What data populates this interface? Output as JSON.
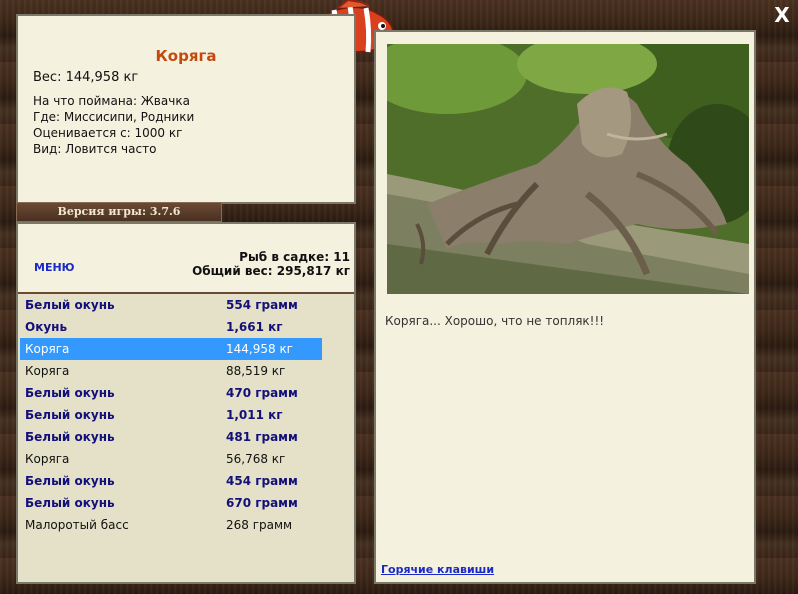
{
  "info": {
    "title": "Коряга",
    "weight": "Вес: 144,958 кг",
    "bait": "На что поймана: Жвачка",
    "location": "Где: Миссисипи, Родники",
    "value": "Оценивается с: 1000 кг",
    "frequency": "Вид: Ловится часто"
  },
  "version": "Версия игры: 3.7.6",
  "catch": {
    "menu_label": "МЕНЮ",
    "count": "Рыб в садке: 11",
    "total": "Общий вес: 295,817 кг",
    "rows": [
      {
        "name": "Белый окунь",
        "weight": "554 грамм",
        "style": "bold"
      },
      {
        "name": "Окунь",
        "weight": "1,661 кг",
        "style": "bold"
      },
      {
        "name": "Коряга",
        "weight": "144,958 кг",
        "style": "selected"
      },
      {
        "name": "Коряга",
        "weight": "88,519 кг",
        "style": "plain"
      },
      {
        "name": "Белый окунь",
        "weight": "470 грамм",
        "style": "bold"
      },
      {
        "name": "Белый окунь",
        "weight": "1,011 кг",
        "style": "bold"
      },
      {
        "name": "Белый окунь",
        "weight": "481 грамм",
        "style": "bold"
      },
      {
        "name": "Коряга",
        "weight": "56,768 кг",
        "style": "plain"
      },
      {
        "name": "Белый окунь",
        "weight": "454 грамм",
        "style": "bold"
      },
      {
        "name": "Белый окунь",
        "weight": "670 грамм",
        "style": "bold"
      },
      {
        "name": "Малоротый басс",
        "weight": "268 грамм",
        "style": "plain"
      }
    ]
  },
  "photo": {
    "comment": "Коряга... Хорошо, что не топляк!!!",
    "hotkeys": "Горячие клавиши"
  },
  "close_label": "X",
  "colors": {
    "title": "#c34a0e",
    "link": "#1a2ac8",
    "highlight": "#3399ff",
    "bold_row": "#13107a"
  }
}
